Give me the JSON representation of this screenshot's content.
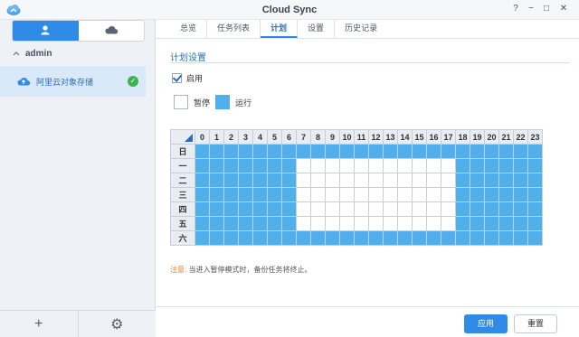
{
  "window": {
    "title": "Cloud Sync",
    "buttons": [
      "?",
      "−",
      "□",
      "✕"
    ]
  },
  "sidebar": {
    "tabs": [
      {
        "icon": "user-icon",
        "active": true
      },
      {
        "icon": "cloud-icon",
        "active": false
      }
    ],
    "group_label": "admin",
    "connections": [
      {
        "label": "阿里云对象存储",
        "status": "ok"
      }
    ],
    "bottom": [
      {
        "icon": "plus-icon",
        "label": "+"
      },
      {
        "icon": "gear-icon",
        "label": "⚙"
      }
    ]
  },
  "tabs": [
    {
      "label": "总览",
      "active": false
    },
    {
      "label": "任务列表",
      "active": false
    },
    {
      "label": "计划",
      "active": true
    },
    {
      "label": "设置",
      "active": false
    },
    {
      "label": "历史记录",
      "active": false
    }
  ],
  "schedule": {
    "section_title": "计划设置",
    "enable_label": "启用",
    "enable_checked": true,
    "legend_pause": "暂停",
    "legend_run": "运行",
    "hours": [
      "0",
      "1",
      "2",
      "3",
      "4",
      "5",
      "6",
      "7",
      "8",
      "9",
      "10",
      "11",
      "12",
      "13",
      "14",
      "15",
      "16",
      "17",
      "18",
      "19",
      "20",
      "21",
      "22",
      "23"
    ],
    "days": [
      {
        "label": "日",
        "off_from": null,
        "off_to": null
      },
      {
        "label": "一",
        "off_from": 7,
        "off_to": 17
      },
      {
        "label": "二",
        "off_from": 7,
        "off_to": 17
      },
      {
        "label": "三",
        "off_from": 7,
        "off_to": 17
      },
      {
        "label": "四",
        "off_from": 7,
        "off_to": 17
      },
      {
        "label": "五",
        "off_from": 7,
        "off_to": 17
      },
      {
        "label": "六",
        "off_from": null,
        "off_to": null
      }
    ],
    "note_label": "注意:",
    "note_text": "当进入暂停模式时，备份任务将终止。"
  },
  "footer": {
    "apply_label": "应用",
    "reset_label": "重置"
  },
  "colors": {
    "accent": "#2e8ce8",
    "run_cell": "#4fb0ec",
    "ok": "#3eb34f"
  }
}
